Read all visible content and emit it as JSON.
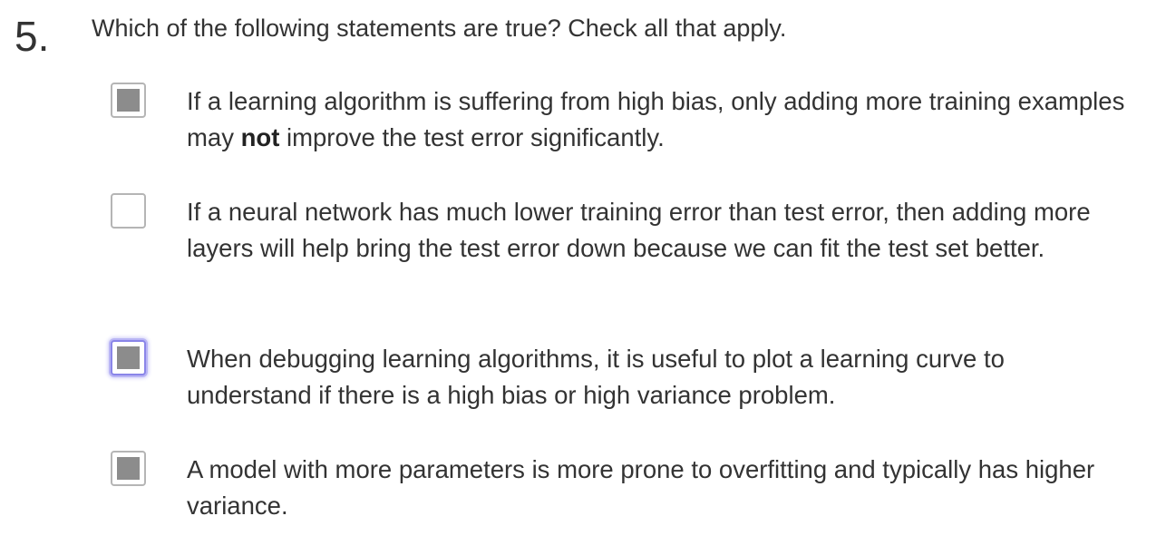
{
  "question": {
    "number": "5.",
    "prompt": "Which of the following statements are true? Check all that apply."
  },
  "options": [
    {
      "checked": true,
      "focused": false,
      "text_before": "If a learning algorithm is suffering from high bias, only adding more training examples may ",
      "text_bold": "not",
      "text_after": " improve the test error significantly."
    },
    {
      "checked": false,
      "focused": false,
      "text": "If a neural network has much lower training error than test error, then adding more layers will help bring the test error down because we can fit the test set better."
    },
    {
      "checked": true,
      "focused": true,
      "text": "When debugging learning algorithms, it is useful to plot a learning curve to understand if there is a high bias or high variance problem."
    },
    {
      "checked": true,
      "focused": false,
      "text": "A model with more parameters is more prone to overfitting and typically has higher variance."
    }
  ],
  "colors": {
    "text": "#333333",
    "checkbox_fill": "#8c8c8c",
    "checkbox_border": "#b5b5b5",
    "focus_ring": "#8a85e8"
  }
}
